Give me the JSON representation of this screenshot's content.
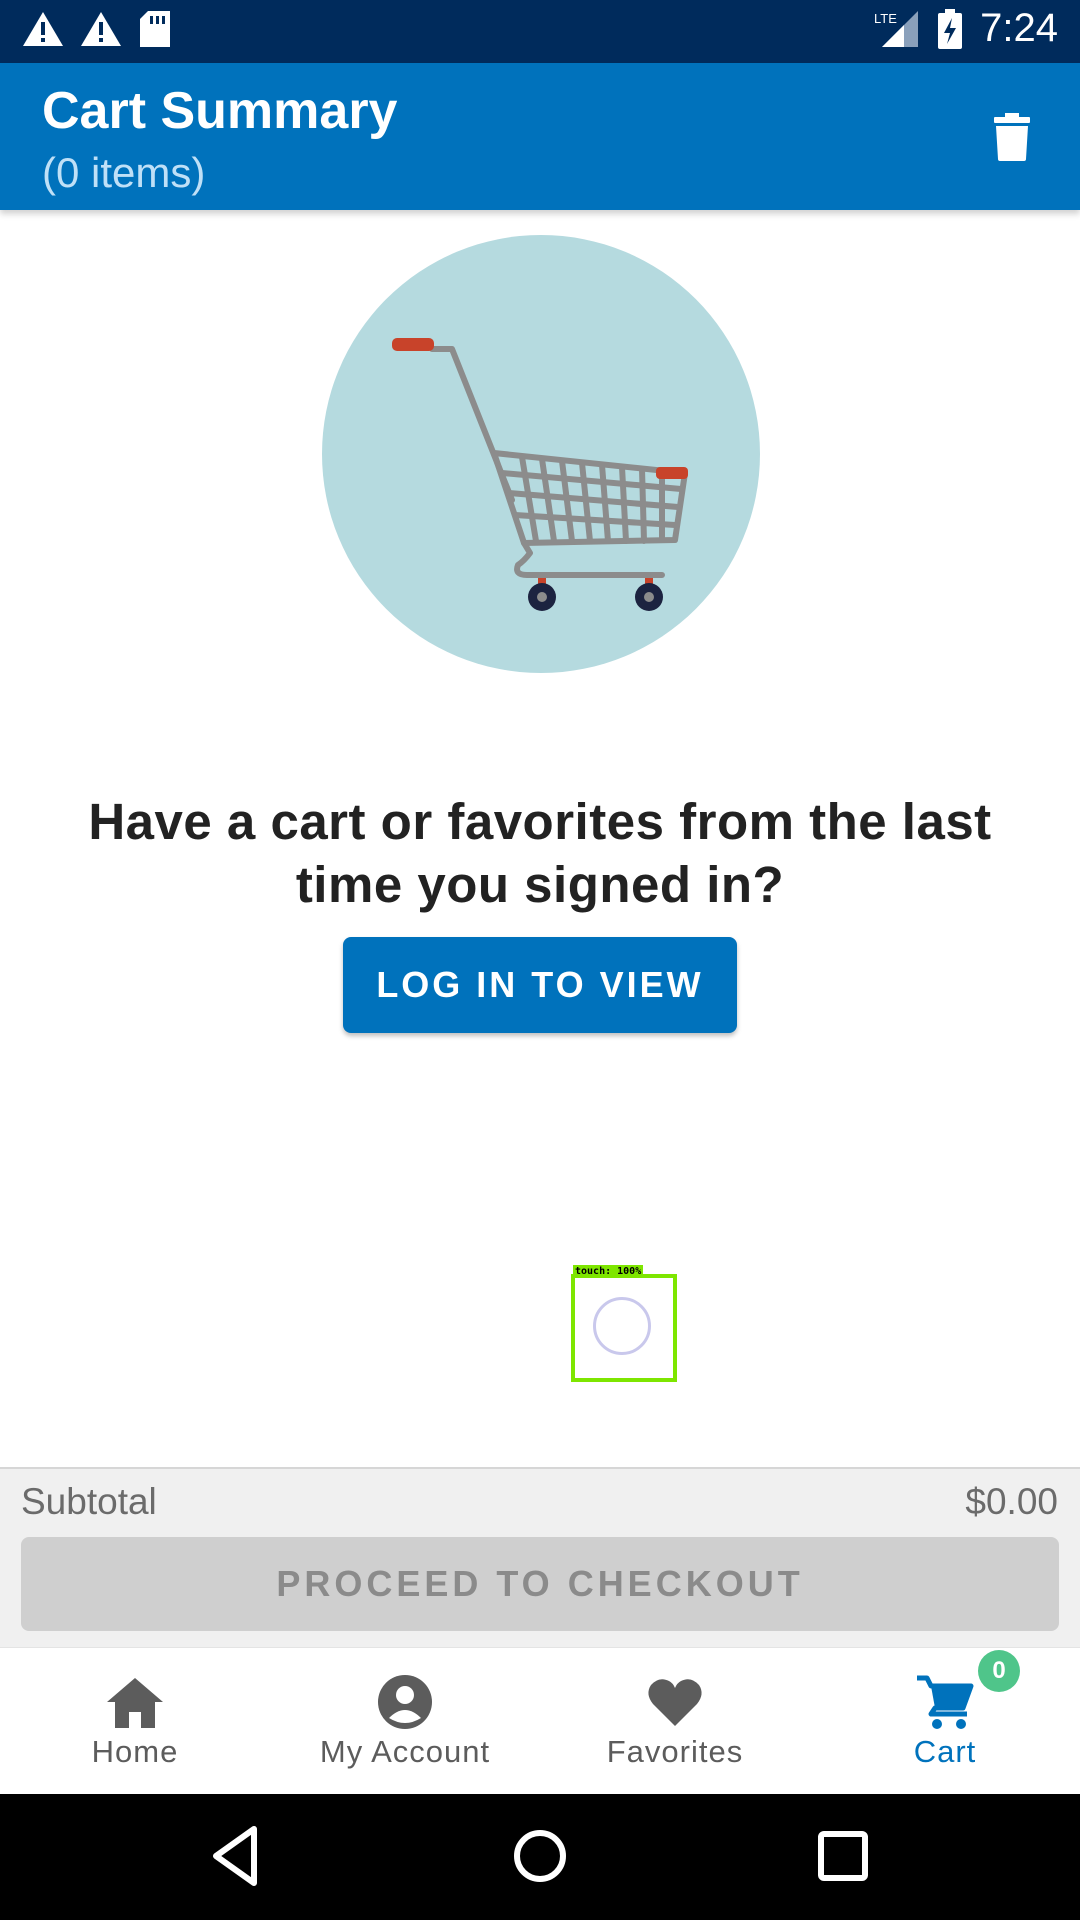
{
  "status_bar": {
    "time": "7:24",
    "network": "LTE",
    "icons": [
      "warning-icon",
      "warning-icon",
      "sd-card-icon",
      "signal-icon",
      "battery-charging-icon"
    ]
  },
  "header": {
    "title": "Cart Summary",
    "subtitle": "(0 items)",
    "actions": [
      "trash-icon"
    ]
  },
  "main": {
    "illustration": "shopping-cart-illustration",
    "prompt": "Have a cart or favorites from the last time you signed in?",
    "login_button": "LOG IN TO VIEW"
  },
  "touch_overlay": {
    "label": "touch: 100%"
  },
  "checkout": {
    "subtotal_label": "Subtotal",
    "subtotal_value": "$0.00",
    "button_label": "PROCEED TO CHECKOUT"
  },
  "bottom_nav": {
    "items": [
      {
        "label": "Home",
        "icon": "home-icon"
      },
      {
        "label": "My Account",
        "icon": "account-icon"
      },
      {
        "label": "Favorites",
        "icon": "heart-icon"
      },
      {
        "label": "Cart",
        "icon": "cart-icon",
        "badge": "0",
        "active": true
      }
    ]
  },
  "system_nav": [
    "back-icon",
    "home-circle-icon",
    "recents-icon"
  ],
  "colors": {
    "status_bar": "#002b5c",
    "primary": "#0072bc",
    "badge": "#4fc58a",
    "illustration_bg": "#b5dadf"
  }
}
